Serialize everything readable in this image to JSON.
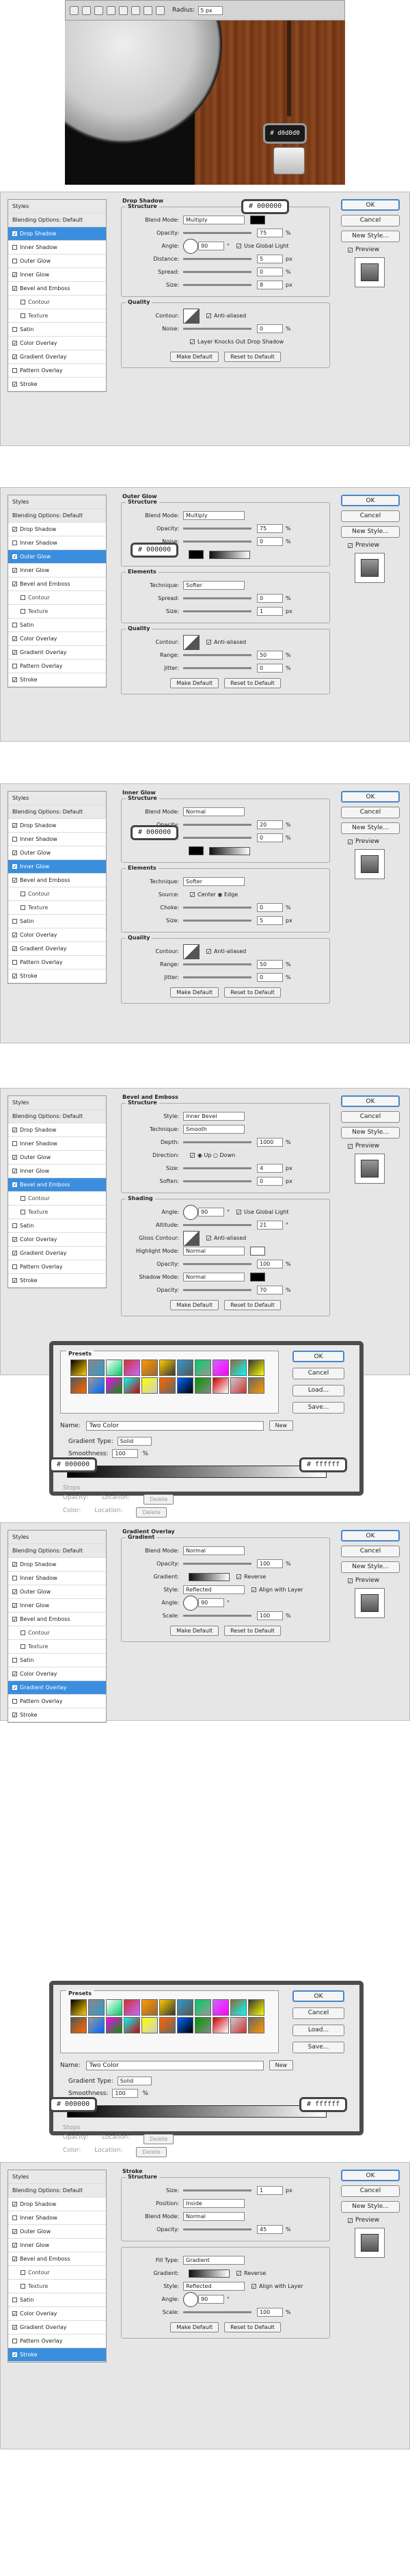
{
  "toolbar": {
    "radius_label": "Radius:",
    "radius_value": "5 px"
  },
  "hero": {
    "badge": "# d0d0d0"
  },
  "common": {
    "ok": "OK",
    "cancel": "Cancel",
    "new_style": "New Style...",
    "preview": "Preview",
    "make_default": "Make Default",
    "reset_default": "Reset to Default",
    "styles_title": "Styles",
    "blending_options": "Blending Options: Default",
    "style_items": [
      "Drop Shadow",
      "Inner Shadow",
      "Outer Glow",
      "Inner Glow",
      "Bevel and Emboss",
      "Contour",
      "Texture",
      "Satin",
      "Color Overlay",
      "Gradient Overlay",
      "Pattern Overlay",
      "Stroke"
    ]
  },
  "panels": [
    {
      "title": "Drop Shadow",
      "selected": 0,
      "checked": [
        0,
        3,
        4,
        8,
        9,
        11
      ],
      "callout": "# 000000",
      "groups": [
        {
          "title": "Structure",
          "rows": [
            {
              "label": "Blend Mode:",
              "select": "Multiply",
              "swatch": "#000000"
            },
            {
              "label": "Opacity:",
              "value": "75",
              "unit": "%"
            },
            {
              "label": "Angle:",
              "value": "90",
              "unit": "°",
              "extra": "Use Global Light",
              "dial": true
            },
            {
              "label": "Distance:",
              "value": "5",
              "unit": "px"
            },
            {
              "label": "Spread:",
              "value": "0",
              "unit": "%"
            },
            {
              "label": "Size:",
              "value": "8",
              "unit": "px"
            }
          ]
        },
        {
          "title": "Quality",
          "rows": [
            {
              "label": "Contour:",
              "curve": true,
              "extra": "Anti-aliased"
            },
            {
              "label": "Noise:",
              "value": "0",
              "unit": "%"
            },
            {
              "label": "",
              "extra": "Layer Knocks Out Drop Shadow"
            }
          ]
        }
      ]
    },
    {
      "title": "Outer Glow",
      "selected": 2,
      "checked": [
        0,
        2,
        3,
        4,
        8,
        9,
        11
      ],
      "callout": "# 000000",
      "groups": [
        {
          "title": "Structure",
          "rows": [
            {
              "label": "Blend Mode:",
              "select": "Multiply"
            },
            {
              "label": "Opacity:",
              "value": "75",
              "unit": "%"
            },
            {
              "label": "Noise:",
              "value": "0",
              "unit": "%"
            },
            {
              "label": "",
              "swatch": "#000000",
              "gradient": true
            }
          ]
        },
        {
          "title": "Elements",
          "rows": [
            {
              "label": "Technique:",
              "select": "Softer"
            },
            {
              "label": "Spread:",
              "value": "0",
              "unit": "%"
            },
            {
              "label": "Size:",
              "value": "1",
              "unit": "px"
            }
          ]
        },
        {
          "title": "Quality",
          "rows": [
            {
              "label": "Contour:",
              "curve": true,
              "extra": "Anti-aliased"
            },
            {
              "label": "Range:",
              "value": "50",
              "unit": "%"
            },
            {
              "label": "Jitter:",
              "value": "0",
              "unit": "%"
            }
          ]
        }
      ]
    },
    {
      "title": "Inner Glow",
      "selected": 3,
      "checked": [
        0,
        2,
        3,
        4,
        8,
        9,
        11
      ],
      "callout": "# 000000",
      "groups": [
        {
          "title": "Structure",
          "rows": [
            {
              "label": "Blend Mode:",
              "select": "Normal"
            },
            {
              "label": "Opacity:",
              "value": "20",
              "unit": "%"
            },
            {
              "label": "Noise:",
              "value": "0",
              "unit": "%"
            },
            {
              "label": "",
              "swatch": "#000000",
              "gradient": true
            }
          ]
        },
        {
          "title": "Elements",
          "rows": [
            {
              "label": "Technique:",
              "select": "Softer"
            },
            {
              "label": "Source:",
              "extra": "Center   ◉ Edge"
            },
            {
              "label": "Choke:",
              "value": "0",
              "unit": "%"
            },
            {
              "label": "Size:",
              "value": "5",
              "unit": "px"
            }
          ]
        },
        {
          "title": "Quality",
          "rows": [
            {
              "label": "Contour:",
              "curve": true,
              "extra": "Anti-aliased"
            },
            {
              "label": "Range:",
              "value": "50",
              "unit": "%"
            },
            {
              "label": "Jitter:",
              "value": "0",
              "unit": "%"
            }
          ]
        }
      ]
    },
    {
      "title": "Bevel and Emboss",
      "selected": 4,
      "checked": [
        0,
        2,
        3,
        4,
        8,
        9,
        11
      ],
      "callout": "",
      "groups": [
        {
          "title": "Structure",
          "rows": [
            {
              "label": "Style:",
              "select": "Inner Bevel"
            },
            {
              "label": "Technique:",
              "select": "Smooth"
            },
            {
              "label": "Depth:",
              "value": "1000",
              "unit": "%"
            },
            {
              "label": "Direction:",
              "extra": "◉ Up   ○ Down"
            },
            {
              "label": "Size:",
              "value": "4",
              "unit": "px"
            },
            {
              "label": "Soften:",
              "value": "0",
              "unit": "px"
            }
          ]
        },
        {
          "title": "Shading",
          "rows": [
            {
              "label": "Angle:",
              "value": "90",
              "unit": "°",
              "dial": true,
              "extra": "Use Global Light"
            },
            {
              "label": "Altitude:",
              "value": "21",
              "unit": "°"
            },
            {
              "label": "Gloss Contour:",
              "curve": true,
              "extra": "Anti-aliased"
            },
            {
              "label": "Highlight Mode:",
              "select": "Normal",
              "swatch": "#ffffff"
            },
            {
              "label": "Opacity:",
              "value": "100",
              "unit": "%"
            },
            {
              "label": "Shadow Mode:",
              "select": "Normal",
              "swatch": "#000000"
            },
            {
              "label": "Opacity:",
              "value": "70",
              "unit": "%"
            }
          ]
        }
      ]
    },
    {
      "title": "Gradient Overlay",
      "selected": 9,
      "checked": [
        0,
        2,
        3,
        4,
        8,
        9,
        11
      ],
      "callout": "",
      "groups": [
        {
          "title": "Gradient",
          "rows": [
            {
              "label": "Blend Mode:",
              "select": "Normal"
            },
            {
              "label": "Opacity:",
              "value": "100",
              "unit": "%"
            },
            {
              "label": "Gradient:",
              "gradient": true,
              "extra": "Reverse"
            },
            {
              "label": "Style:",
              "select": "Reflected",
              "extra": "Align with Layer"
            },
            {
              "label": "Angle:",
              "value": "90",
              "unit": "°",
              "dial": true
            },
            {
              "label": "Scale:",
              "value": "100",
              "unit": "%"
            }
          ]
        }
      ]
    },
    {
      "title": "Stroke",
      "selected": 11,
      "checked": [
        0,
        2,
        3,
        4,
        8,
        9,
        11
      ],
      "callout": "",
      "groups": [
        {
          "title": "Structure",
          "rows": [
            {
              "label": "Size:",
              "value": "1",
              "unit": "px"
            },
            {
              "label": "Position:",
              "select": "Inside"
            },
            {
              "label": "Blend Mode:",
              "select": "Normal"
            },
            {
              "label": "Opacity:",
              "value": "45",
              "unit": "%"
            }
          ]
        },
        {
          "title": "",
          "rows": [
            {
              "label": "Fill Type:",
              "select": "Gradient"
            },
            {
              "label": "Gradient:",
              "gradient": true,
              "extra": "Reverse"
            },
            {
              "label": "Style:",
              "select": "Reflected",
              "extra": "Align with Layer"
            },
            {
              "label": "Angle:",
              "value": "90",
              "unit": "°",
              "dial": true
            },
            {
              "label": "Scale:",
              "value": "100",
              "unit": "%"
            }
          ]
        }
      ]
    }
  ],
  "editors": [
    {
      "name_label": "Name:",
      "name_value": "Two Color",
      "new_btn": "New",
      "type_label": "Gradient Type:",
      "type_value": "Solid",
      "smooth_label": "Smoothness:",
      "smooth_value": "100",
      "left_stop": "# 000000",
      "right_stop": "# ffffff",
      "presets_label": "Presets",
      "stops_label": "Stops",
      "opacity_label": "Opacity:",
      "location_label": "Location:",
      "delete": "Delete",
      "color_label": "Color:",
      "btn_ok": "OK",
      "btn_cancel": "Cancel",
      "btn_load": "Load...",
      "btn_save": "Save..."
    },
    {
      "name_label": "Name:",
      "name_value": "Two Color",
      "new_btn": "New",
      "type_label": "Gradient Type:",
      "type_value": "Solid",
      "smooth_label": "Smoothness:",
      "smooth_value": "100",
      "left_stop": "# 000000",
      "right_stop": "# ffffff",
      "presets_label": "Presets",
      "stops_label": "Stops",
      "opacity_label": "Opacity:",
      "location_label": "Location:",
      "delete": "Delete",
      "color_label": "Color:",
      "btn_ok": "OK",
      "btn_cancel": "Cancel",
      "btn_load": "Load...",
      "btn_save": "Save..."
    }
  ]
}
